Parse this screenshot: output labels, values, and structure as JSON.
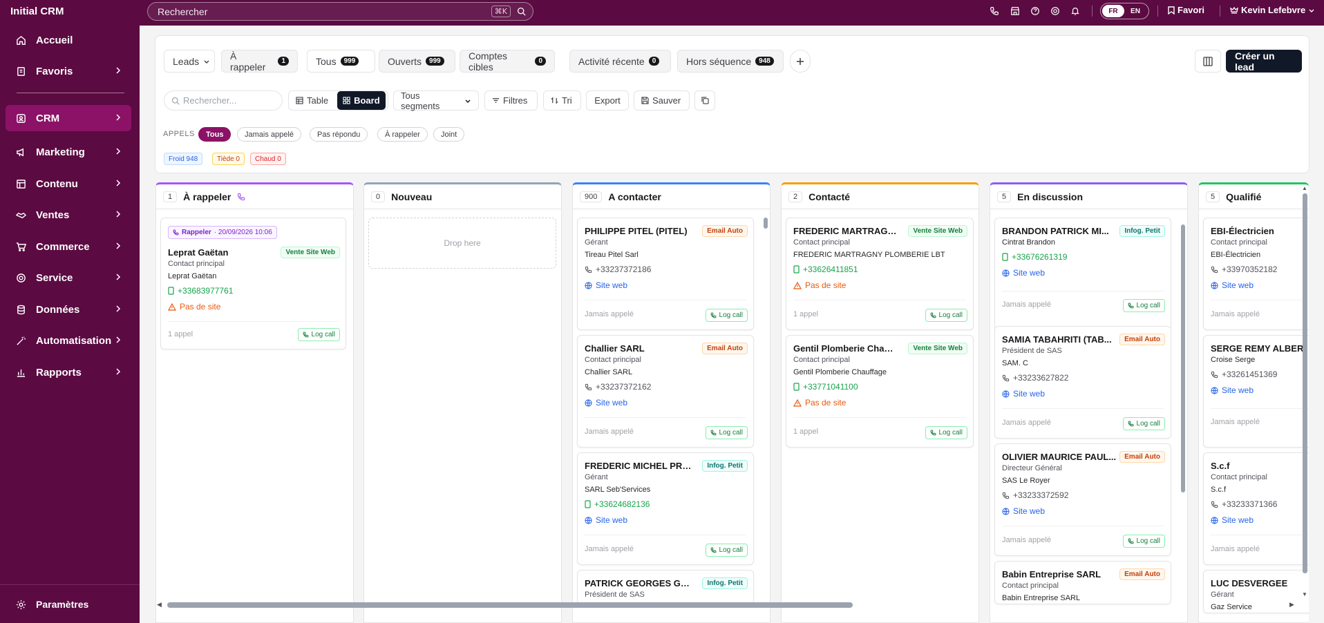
{
  "app": {
    "title": "Initial CRM"
  },
  "sidebar": {
    "items": [
      {
        "label": "Accueil"
      },
      {
        "label": "Favoris"
      },
      {
        "label": "CRM"
      },
      {
        "label": "Marketing"
      },
      {
        "label": "Contenu"
      },
      {
        "label": "Ventes"
      },
      {
        "label": "Commerce"
      },
      {
        "label": "Service"
      },
      {
        "label": "Données"
      },
      {
        "label": "Automatisation"
      },
      {
        "label": "Rapports"
      }
    ],
    "settings_label": "Paramètres"
  },
  "topbar": {
    "search_placeholder": "Rechercher",
    "shortcut": "⌘K",
    "lang_fr": "FR",
    "lang_en": "EN",
    "favori_label": "Favori",
    "user_name": "Kevin Lefebvre"
  },
  "tabs": {
    "entity": "Leads",
    "items": [
      {
        "label": "À rappeler",
        "count": "1"
      },
      {
        "label": "Tous",
        "count": "999"
      },
      {
        "label": "Ouverts",
        "count": "999"
      },
      {
        "label": "Comptes cibles",
        "count": "0"
      },
      {
        "label": "Activité récente",
        "count": "0"
      },
      {
        "label": "Hors séquence",
        "count": "948"
      }
    ],
    "create_label": "Créer un lead"
  },
  "toolbar": {
    "search_placeholder": "Rechercher...",
    "table_label": "Table",
    "board_label": "Board",
    "segments_label": "Tous segments",
    "filters_label": "Filtres",
    "sort_label": "Tri",
    "export_label": "Export",
    "save_label": "Sauver"
  },
  "calls_filter": {
    "label": "APPELS",
    "options": [
      "Tous",
      "Jamais appelé",
      "Pas répondu",
      "À rappeler",
      "Joint"
    ]
  },
  "temperature": {
    "cold": "Froid 948",
    "warm": "Tiède 0",
    "hot": "Chaud 0"
  },
  "colors": {
    "brand": "#5b0a42",
    "brand_active": "#8b1266",
    "dark": "#111827"
  },
  "board": {
    "log_call_label": "Log call",
    "drop_here": "Drop here",
    "columns": [
      {
        "name": "À rappeler",
        "count": "1",
        "color": "#a855f7",
        "cards": [
          {
            "callback_label": "Rappeler",
            "callback_date": "· 20/09/2026 10:06",
            "name": "Leprat Gaëtan",
            "badge": "Vente Site Web",
            "role": "Contact principal",
            "company": "Leprat Gaëtan",
            "contact": "+33683977761",
            "site": "Pas de site",
            "status": "1 appel"
          }
        ]
      },
      {
        "name": "Nouveau",
        "count": "0",
        "color": "#94a3b8",
        "cards": []
      },
      {
        "name": "A contacter",
        "count": "900",
        "color": "#3b82f6",
        "cards": [
          {
            "name": "PHILIPPE PITEL (PITEL)",
            "badge": "Email Auto",
            "role": "Gérant",
            "company": "Tireau Pitel Sarl",
            "contact": "+33237372186",
            "site": "Site web",
            "status": "Jamais appelé"
          },
          {
            "name": "Challier SARL",
            "badge": "Email Auto",
            "role": "Contact principal",
            "company": "Challier SARL",
            "contact": "+33237372162",
            "site": "Site web",
            "status": "Jamais appelé"
          },
          {
            "name": "FREDERIC MICHEL PRU...",
            "badge": "Infog. Petit",
            "role": "Gérant",
            "company": "SARL Seb'Services",
            "contact": "+33624682136",
            "site": "Site web",
            "status": "Jamais appelé"
          },
          {
            "name": "PATRICK GEORGES GUY...",
            "badge": "Infog. Petit",
            "role": "Président de SAS"
          }
        ]
      },
      {
        "name": "Contacté",
        "count": "2",
        "color": "#f59e0b",
        "cards": [
          {
            "name": "FREDERIC MARTRAGN...",
            "badge": "Vente Site Web",
            "role": "Contact principal",
            "company": "FREDERIC MARTRAGNY PLOMBERIE LBT",
            "contact": "+33626411851",
            "site": "Pas de site",
            "status": "1 appel"
          },
          {
            "name": "Gentil Plomberie Chauf...",
            "badge": "Vente Site Web",
            "role": "Contact principal",
            "company": "Gentil Plomberie Chauffage",
            "contact": "+33771041100",
            "site": "Pas de site",
            "status": "1 appel"
          }
        ]
      },
      {
        "name": "En discussion",
        "count": "5",
        "color": "#8b5cf6",
        "cards": [
          {
            "name": "BRANDON PATRICK MI...",
            "badge": "Infog. Petit",
            "role": "Cintrat Brandon",
            "contact": "+33676261319",
            "site": "Site web",
            "status": "Jamais appelé"
          },
          {
            "name": "SAMIA TABAHRITI (TAB...",
            "badge": "Email Auto",
            "role": "Président de SAS",
            "company": "SAM. C",
            "contact": "+33233627822",
            "site": "Site web",
            "status": "Jamais appelé"
          },
          {
            "name": "OLIVIER MAURICE PAUL...",
            "badge": "Email Auto",
            "role": "Directeur Général",
            "company": "SAS Le Royer",
            "contact": "+33233372592",
            "site": "Site web",
            "status": "Jamais appelé"
          },
          {
            "name": "Babin Entreprise SARL",
            "badge": "Email Auto",
            "role": "Contact principal",
            "company": "Babin Entreprise SARL"
          }
        ]
      },
      {
        "name": "Qualifié",
        "count": "5",
        "color": "#22c55e",
        "cards": [
          {
            "name": "EBI-Électricien",
            "role": "Contact principal",
            "company": "EBI-Électricien",
            "contact": "+33970352182",
            "site": "Site web",
            "status": "Jamais appelé"
          },
          {
            "name": "SERGE REMY ALBER",
            "role": "Croise Serge",
            "contact": "+33261451369",
            "site": "Site web",
            "status": "Jamais appelé"
          },
          {
            "name": "S.c.f",
            "role": "Contact principal",
            "company": "S.c.f",
            "contact": "+33233371366",
            "site": "Site web",
            "status": "Jamais appelé"
          },
          {
            "name": "LUC DESVERGEE",
            "role": "Gérant",
            "company": "Gaz Service"
          }
        ]
      }
    ]
  }
}
